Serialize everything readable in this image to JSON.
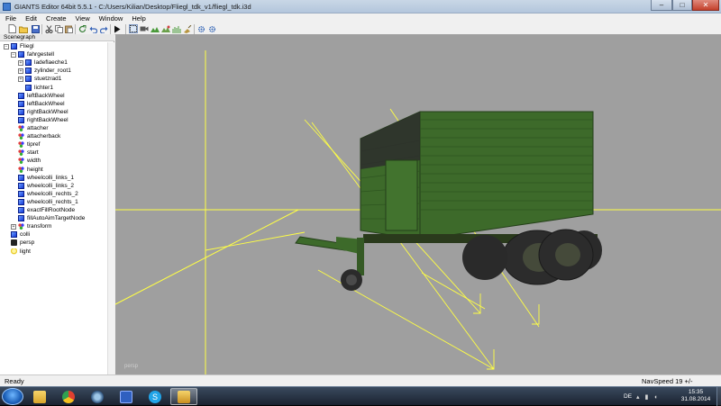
{
  "window": {
    "title": "GIANTS Editor 64bit 5.5.1 - C:/Users/Kilian/Desktop/Fliegl_tdk_v1/fliegl_tdk.i3d",
    "minimize_glyph": "–",
    "maximize_glyph": "□",
    "close_glyph": "✕"
  },
  "menu": [
    "File",
    "Edit",
    "Create",
    "View",
    "Window",
    "Help"
  ],
  "toolbar": {
    "icons": [
      "new-file-icon",
      "open-folder-icon",
      "save-icon",
      "cut-icon",
      "copy-icon",
      "paste-icon",
      "refresh-icon",
      "undo-icon",
      "redo-icon",
      "play-icon",
      "select-icon",
      "camera-icon",
      "terrain-icon",
      "paint-icon",
      "foliage-icon",
      "settings-icon"
    ]
  },
  "scenegraph": {
    "header": "Scenegraph",
    "nodes": [
      {
        "label": "Fliegl",
        "icon": "cube",
        "depth": 0,
        "expander": "−"
      },
      {
        "label": "fahrgestell",
        "icon": "cube",
        "depth": 1,
        "expander": "−"
      },
      {
        "label": "ladeflaeche1",
        "icon": "cube",
        "depth": 2,
        "expander": "+"
      },
      {
        "label": "zylinder_root1",
        "icon": "cube",
        "depth": 2,
        "expander": "+"
      },
      {
        "label": "stuetzrad1",
        "icon": "cube",
        "depth": 2,
        "expander": "+"
      },
      {
        "label": "lichter1",
        "icon": "cube",
        "depth": 2,
        "expander": ""
      },
      {
        "label": "leftBackWheel",
        "icon": "cube",
        "depth": 1,
        "expander": ""
      },
      {
        "label": "leftBackWheel",
        "icon": "cube",
        "depth": 1,
        "expander": ""
      },
      {
        "label": "rightBackWheel",
        "icon": "cube",
        "depth": 1,
        "expander": ""
      },
      {
        "label": "rightBackWheel",
        "icon": "cube",
        "depth": 1,
        "expander": ""
      },
      {
        "label": "attacher",
        "icon": "dots",
        "depth": 1,
        "expander": ""
      },
      {
        "label": "attacherback",
        "icon": "dots",
        "depth": 1,
        "expander": ""
      },
      {
        "label": "tipref",
        "icon": "dots",
        "depth": 1,
        "expander": ""
      },
      {
        "label": "start",
        "icon": "dots",
        "depth": 1,
        "expander": ""
      },
      {
        "label": "width",
        "icon": "dots",
        "depth": 1,
        "expander": ""
      },
      {
        "label": "height",
        "icon": "dots",
        "depth": 1,
        "expander": ""
      },
      {
        "label": "wheelcolli_links_1",
        "icon": "cube",
        "depth": 1,
        "expander": ""
      },
      {
        "label": "wheelcolli_links_2",
        "icon": "cube",
        "depth": 1,
        "expander": ""
      },
      {
        "label": "wheelcolli_rechts_2",
        "icon": "cube",
        "depth": 1,
        "expander": ""
      },
      {
        "label": "wheelcolli_rechts_1",
        "icon": "cube",
        "depth": 1,
        "expander": ""
      },
      {
        "label": "exactFillRootNode",
        "icon": "cube",
        "depth": 1,
        "expander": ""
      },
      {
        "label": "fillAutoAimTargetNode",
        "icon": "cube",
        "depth": 1,
        "expander": ""
      },
      {
        "label": "transform",
        "icon": "dots",
        "depth": 1,
        "expander": "+"
      },
      {
        "label": "colli",
        "icon": "cube",
        "depth": 0,
        "expander": ""
      },
      {
        "label": "persp",
        "icon": "cam",
        "depth": 0,
        "expander": ""
      },
      {
        "label": "light",
        "icon": "bulb",
        "depth": 0,
        "expander": ""
      }
    ]
  },
  "viewport": {
    "camera_label": "persp",
    "background": "#9f9f9f",
    "gizmo_color": "#ffff44",
    "trailer_color": "#3f6b2a"
  },
  "status": {
    "left": "Ready",
    "right": "NavSpeed 19 +/-"
  },
  "taskbar": {
    "apps": [
      "internet-explorer-icon",
      "file-explorer-icon",
      "chrome-icon",
      "media-player-icon",
      "giants-editor-icon",
      "skype-icon",
      "image-viewer-icon"
    ],
    "language": "DE",
    "time": "15:35",
    "date": "31.08.2014"
  }
}
